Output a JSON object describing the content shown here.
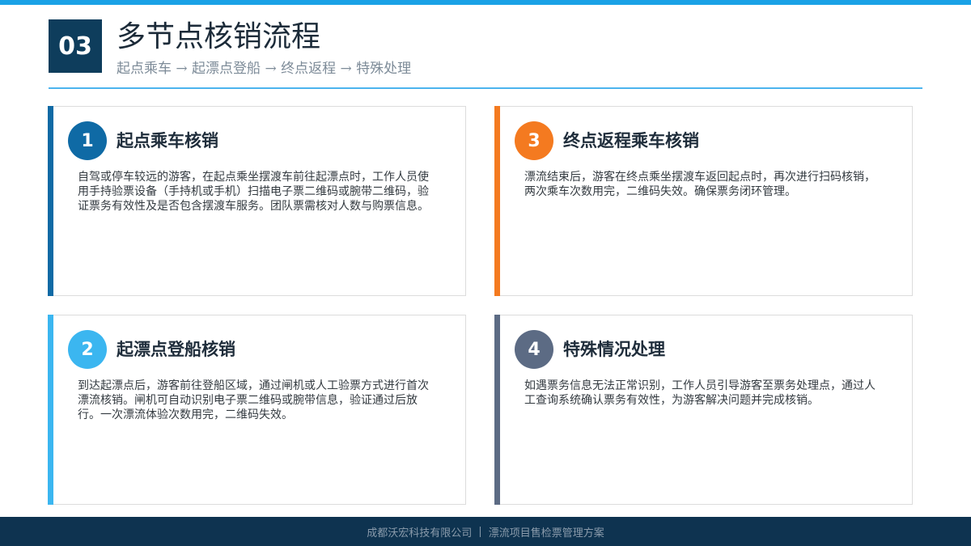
{
  "header": {
    "section_number": "03",
    "title": "多节点核销流程",
    "subtitle": "起点乘车 → 起漂点登船 → 终点返程 → 特殊处理"
  },
  "colors": {
    "accent_top": "#1aa1e6",
    "badge": "#0e3d5c",
    "card_1": "#0f6aa5",
    "card_2": "#3bb6f0",
    "card_3": "#f47a20",
    "card_4": "#5c6b84",
    "footer": "#0e3350"
  },
  "cards": [
    {
      "number": "1",
      "title": "起点乘车核销",
      "body": "自驾或停车较远的游客，在起点乘坐摆渡车前往起漂点时，工作人员使用手持验票设备（手持机或手机）扫描电子票二维码或腕带二维码，验证票务有效性及是否包含摆渡车服务。团队票需核对人数与购票信息。"
    },
    {
      "number": "2",
      "title": "起漂点登船核销",
      "body": "到达起漂点后，游客前往登船区域，通过闸机或人工验票方式进行首次漂流核销。闸机可自动识别电子票二维码或腕带信息，验证通过后放行。一次漂流体验次数用完，二维码失效。"
    },
    {
      "number": "3",
      "title": "终点返程乘车核销",
      "body": "漂流结束后，游客在终点乘坐摆渡车返回起点时，再次进行扫码核销，两次乘车次数用完，二维码失效。确保票务闭环管理。"
    },
    {
      "number": "4",
      "title": "特殊情况处理",
      "body": "如遇票务信息无法正常识别，工作人员引导游客至票务处理点，通过人工查询系统确认票务有效性，为游客解决问题并完成核销。"
    }
  ],
  "footer": {
    "company": "成都沃宏科技有限公司",
    "separator": "|",
    "project": "漂流项目售检票管理方案"
  }
}
